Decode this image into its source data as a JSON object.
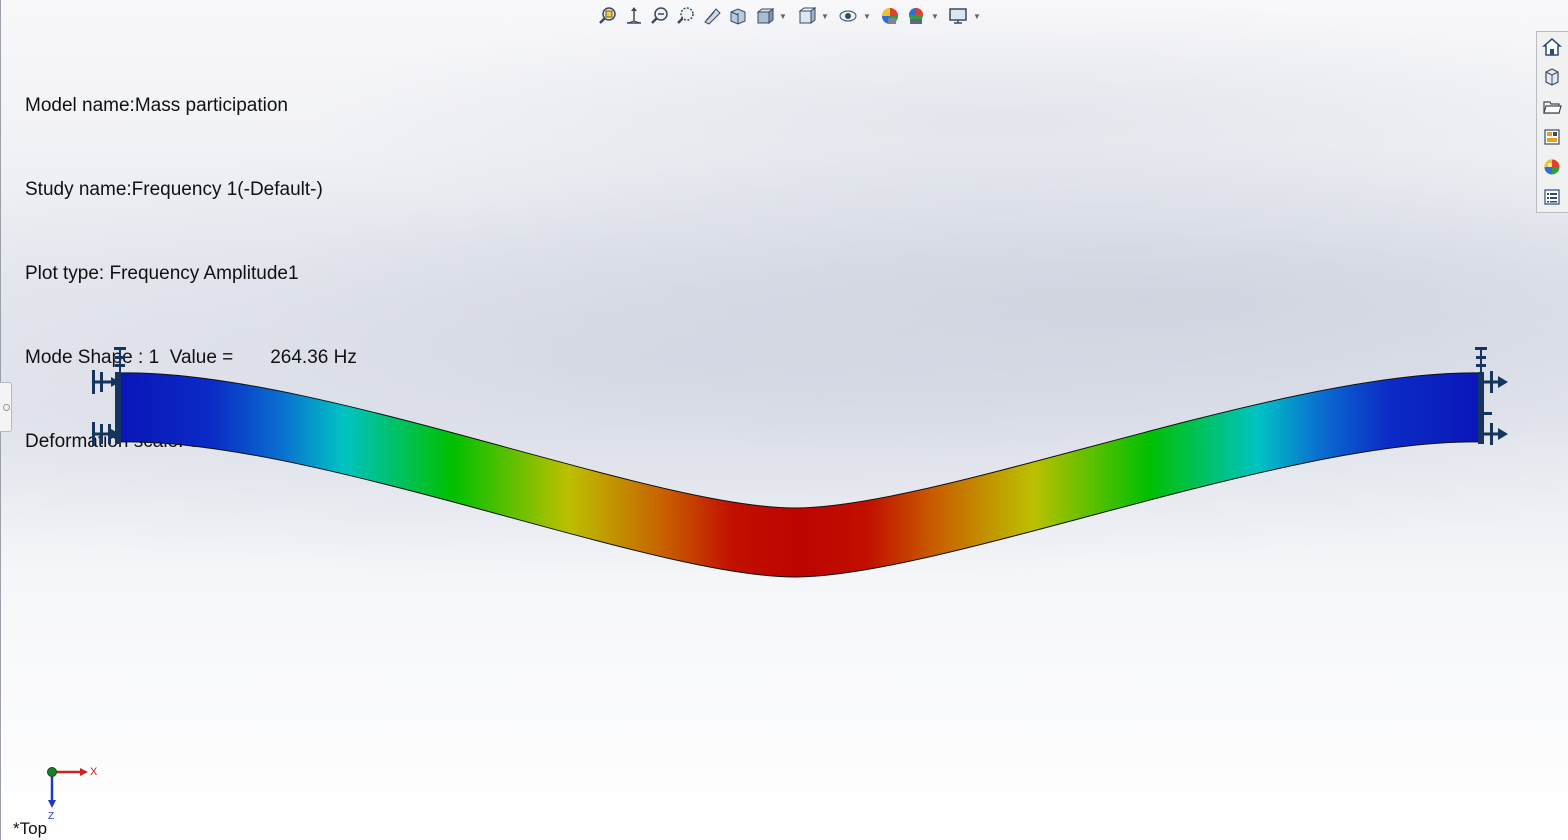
{
  "info": {
    "model_name": "Model name:Mass participation",
    "study_name": "Study name:Frequency 1(-Default-)",
    "plot_type": "Plot type: Frequency Amplitude1",
    "mode_shape": "Mode Shape : 1  Value =       264.36 Hz",
    "deformation_scale": "Deformation scale: 0.392403"
  },
  "toolbar": {
    "icons": [
      "zoom-to-fit-icon",
      "zoom-to-area-icon",
      "previous-view-icon",
      "section-view-icon",
      "dynamic-annotation-icon",
      "view-orientation-icon",
      "display-style-icon",
      "hide-show-items-icon",
      "edit-appearance-icon",
      "apply-scene-icon",
      "view-settings-icon"
    ]
  },
  "right_panel": {
    "icons": [
      "home-icon",
      "parts-library-icon",
      "file-explorer-icon",
      "view-palette-icon",
      "appearances-icon",
      "custom-properties-icon"
    ]
  },
  "triad": {
    "x_label": "X",
    "z_label": "Z"
  },
  "view_label": "*Top",
  "colors": {
    "beam_blue": "#0a1cc0",
    "beam_cyan": "#00c3c3",
    "beam_green": "#00c000",
    "beam_yellow": "#bcc000",
    "beam_red": "#c00800",
    "fixture_color": "#0d2b5a"
  }
}
